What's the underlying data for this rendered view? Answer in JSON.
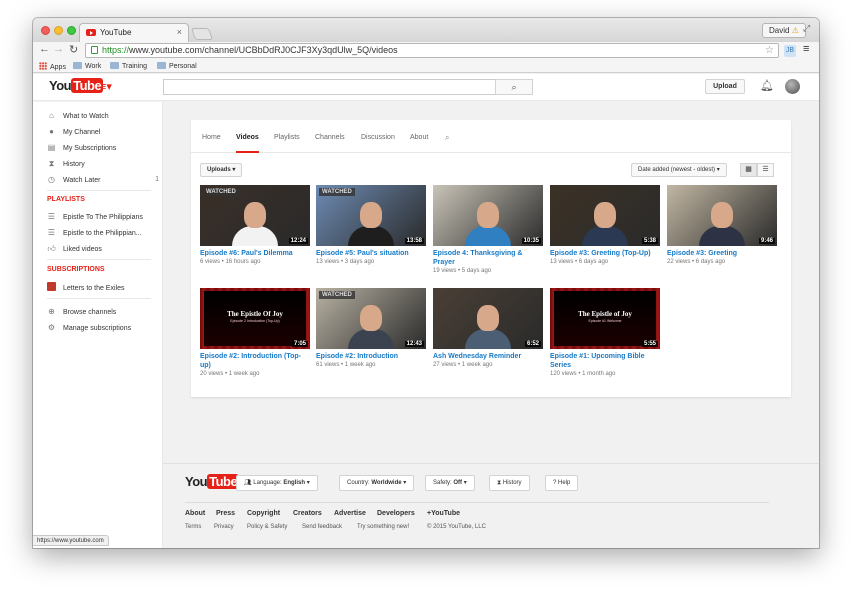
{
  "browser": {
    "tab_title": "YouTube",
    "tab_close": "×",
    "profile_name": "David",
    "profile_warning": "⚠",
    "url_scheme": "https://",
    "url_rest": "www.youtube.com/channel/UCBbDdRJ0CJF3Xy3qdUlw_5Q/videos",
    "bookmarks": [
      "Apps",
      "Work",
      "Training",
      "Personal"
    ],
    "status_url": "https://www.youtube.com"
  },
  "masthead": {
    "logo_you": "You",
    "logo_tube": "Tube",
    "search_placeholder": "",
    "upload_label": "Upload"
  },
  "guide": {
    "items": [
      {
        "label": "What to Watch",
        "icon": "home-icon"
      },
      {
        "label": "My Channel",
        "icon": "person-icon"
      },
      {
        "label": "My Subscriptions",
        "icon": "subscriptions-icon"
      },
      {
        "label": "History",
        "icon": "hourglass-icon"
      },
      {
        "label": "Watch Later",
        "icon": "clock-icon",
        "count": "1"
      }
    ],
    "playlists_heading": "PLAYLISTS",
    "playlists": [
      {
        "label": "Epistle To The Philippians",
        "icon": "playlist-icon"
      },
      {
        "label": "Epistle to the Philippian...",
        "icon": "playlist-icon"
      },
      {
        "label": "Liked videos",
        "icon": "thumbs-up-icon"
      }
    ],
    "subscriptions_heading": "SUBSCRIPTIONS",
    "subscriptions": [
      {
        "label": "Letters to the Exiles"
      }
    ],
    "bottom": [
      {
        "label": "Browse channels",
        "icon": "plus-circle-icon"
      },
      {
        "label": "Manage subscriptions",
        "icon": "gear-icon"
      }
    ]
  },
  "channel_tabs": [
    "Home",
    "Videos",
    "Playlists",
    "Channels",
    "Discussion",
    "About"
  ],
  "active_tab": "Videos",
  "filters": {
    "uploads_label": "Uploads",
    "sort_label": "Date added (newest - oldest)"
  },
  "videos": [
    {
      "title": "Episode #6: Paul's Dilemma",
      "meta": "6 views • 16 hours ago",
      "duration": "12:24",
      "watched": "WATCHED",
      "style": "man",
      "bg": "#3a2f28",
      "shirt": "#f2f2f2"
    },
    {
      "title": "Episode #5: Paul's situation",
      "meta": "13 views • 3 days ago",
      "duration": "13:58",
      "watched": "WATCHED",
      "style": "man",
      "bg": "#6d8bb3",
      "shirt": "#1e1e1e"
    },
    {
      "title": "Episode 4: Thanksgiving & Prayer",
      "meta": "19 views • 5 days ago",
      "duration": "10:35",
      "watched": "",
      "style": "man",
      "bg": "#c9c4b8",
      "shirt": "#2f7fc1"
    },
    {
      "title": "Episode #3: Greeting (Top-Up)",
      "meta": "13 views • 6 days ago",
      "duration": "5:38",
      "watched": "",
      "style": "man",
      "bg": "#3c3226",
      "shirt": "#2b3a52"
    },
    {
      "title": "Episode #3: Greeting",
      "meta": "22 views • 6 days ago",
      "duration": "9:46",
      "watched": "",
      "style": "man",
      "bg": "#c2b7a3",
      "shirt": "#2d3344"
    },
    {
      "title": "Episode #2: Introduction (Top-up)",
      "meta": "20 views • 1 week ago",
      "duration": "7:05",
      "watched": "",
      "style": "curtain",
      "curtain_title": "The Epistle Of Joy",
      "curtain_sub": "Episode 2 Introduction (Top-Up)"
    },
    {
      "title": "Episode #2: Introduction",
      "meta": "61 views • 1 week ago",
      "duration": "12:43",
      "watched": "WATCHED",
      "style": "man",
      "bg": "#b9b2a3",
      "shirt": "#3b4250"
    },
    {
      "title": "Ash Wednesday Reminder",
      "meta": "27 views • 1 week ago",
      "duration": "6:52",
      "watched": "",
      "style": "man",
      "bg": "#4a3f36",
      "shirt": "#4b5e74"
    },
    {
      "title": "Episode #1: Upcoming Bible Series",
      "meta": "120 views • 1 month ago",
      "duration": "5:55",
      "watched": "",
      "style": "curtain",
      "curtain_title": "The Epistle of Joy",
      "curtain_sub": "Episode #1 Welcome"
    }
  ],
  "footer": {
    "logo_you": "You",
    "logo_tube": "Tube",
    "language_label": "Language:",
    "language_value": "English",
    "country_label": "Country:",
    "country_value": "Worldwide",
    "safety_label": "Safety:",
    "safety_value": "Off",
    "history_label": "History",
    "help_label": "Help",
    "links_primary": [
      "About",
      "Press",
      "Copyright",
      "Creators",
      "Advertise",
      "Developers",
      "+YouTube"
    ],
    "links_secondary": [
      "Terms",
      "Privacy",
      "Policy & Safety",
      "Send feedback",
      "Try something new!",
      "© 2015 YouTube, LLC"
    ]
  },
  "colors": {
    "brand_red": "#e62117",
    "link_blue": "#167ac6",
    "curtain_red": "#8e1010"
  }
}
